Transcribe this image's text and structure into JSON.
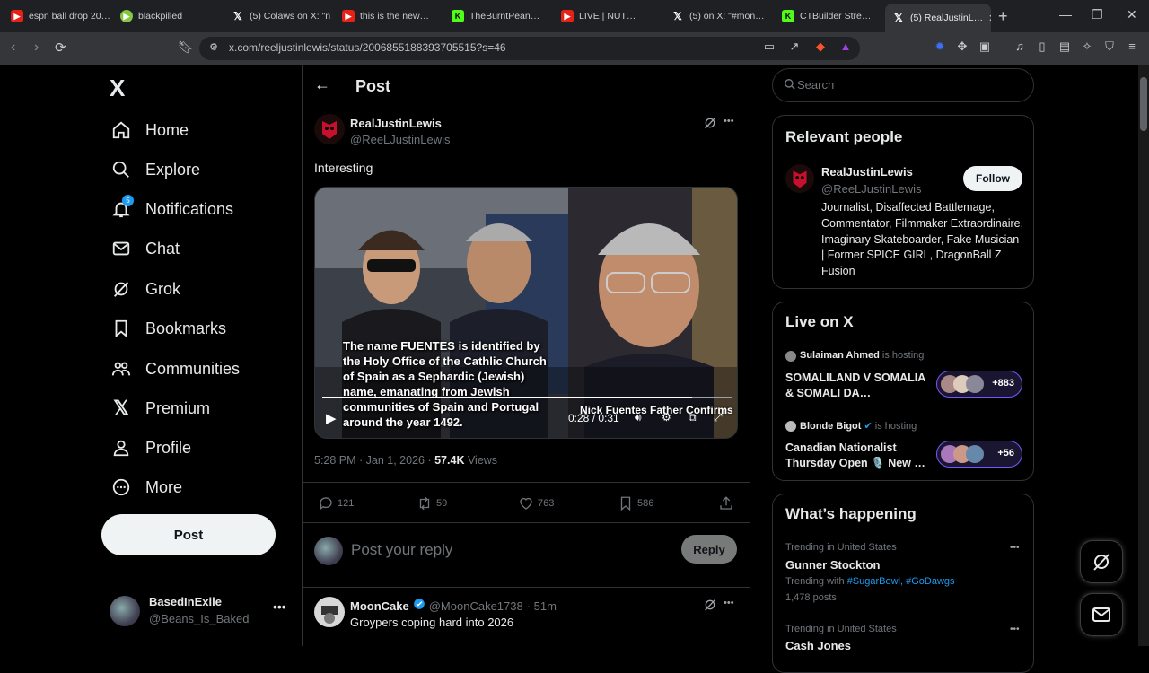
{
  "browser": {
    "tabs": [
      {
        "title": "espn ball drop 20…",
        "icon": "youtube-icon"
      },
      {
        "title": "blackpilled",
        "icon": "rumble-icon"
      },
      {
        "title": "(5) Colaws on X: \"n…",
        "icon": "x-icon"
      },
      {
        "title": "this is the new…",
        "icon": "youtube-icon"
      },
      {
        "title": "TheBurntPean…",
        "icon": "kick-icon"
      },
      {
        "title": "LIVE | NUT…",
        "icon": "youtube-icon"
      },
      {
        "title": "(5) on X: \"#mon…",
        "icon": "x-icon"
      },
      {
        "title": "CTBuilder Stre…",
        "icon": "kick-icon"
      },
      {
        "title": "(5) RealJustinL…",
        "icon": "x-icon",
        "active": true
      }
    ],
    "url": "x.com/reeljustinlewis/status/2006855188393705515?s=46"
  },
  "nav": {
    "logo": "X",
    "items": [
      {
        "label": "Home",
        "icon": "home-icon"
      },
      {
        "label": "Explore",
        "icon": "search-icon"
      },
      {
        "label": "Notifications",
        "icon": "bell-icon",
        "badge": "5"
      },
      {
        "label": "Chat",
        "icon": "mail-icon"
      },
      {
        "label": "Grok",
        "icon": "grok-icon"
      },
      {
        "label": "Bookmarks",
        "icon": "bookmark-icon"
      },
      {
        "label": "Communities",
        "icon": "communities-icon"
      },
      {
        "label": "Premium",
        "icon": "x-premium-icon"
      },
      {
        "label": "Profile",
        "icon": "person-icon"
      },
      {
        "label": "More",
        "icon": "more-circle-icon"
      }
    ],
    "post_button": "Post",
    "account": {
      "name": "BasedInExile",
      "handle": "@Beans_Is_Baked"
    }
  },
  "post": {
    "header": "Post",
    "author_name": "RealJustinLewis",
    "author_handle": "@ReeLJustinLewis",
    "text": "Interesting",
    "video": {
      "caption": "The name FUENTES is identified by the Holy Office of the Cathlic Church of Spain as a Sephardic (Jewish) name, emanating from Jewish communities of Spain and Portugal around the year 1492.",
      "overlay_title": "Nick Fuentes Father Confirms",
      "time": "0:28 / 0:31",
      "progress": 0.903
    },
    "timestamp": "5:28 PM · Jan 1, 2026 · ",
    "views_count": "57.4K",
    "views_label": " Views",
    "stats": {
      "replies": "121",
      "reposts": "59",
      "likes": "763",
      "bookmarks": "586"
    },
    "reply_placeholder": "Post your reply",
    "reply_button": "Reply"
  },
  "comment": {
    "name": "MoonCake",
    "handle": "@MoonCake1738",
    "time": "· 51m",
    "text": "Groypers coping hard into 2026"
  },
  "sidebar": {
    "search_placeholder": "Search",
    "relevant": {
      "title": "Relevant people",
      "name": "RealJustinLewis",
      "handle": "@ReeLJustinLewis",
      "follow": "Follow",
      "bio": "Journalist, Disaffected Battlemage, Commentator, Filmmaker Extraordinaire, Imaginary Skateboarder, Fake Musician | Former SPICE GIRL, DragonBall Z Fusion"
    },
    "live": {
      "title": "Live on X",
      "items": [
        {
          "host": "Sulaiman Ahmed",
          "suffix": "is hosting",
          "title": "SOMALILAND V SOMALIA & SOMALI DA…",
          "count": "+883"
        },
        {
          "host": "Blonde Bigot",
          "suffix": "is hosting",
          "title": "Canadian Nationalist Thursday Open 🎙️ New …",
          "count": "+56"
        }
      ]
    },
    "happening": {
      "title": "What’s happening",
      "trends": [
        {
          "context": "Trending in United States",
          "name": "Gunner Stockton",
          "with_label": "Trending with ",
          "tags": "#SugarBowl, #GoDawgs",
          "posts": "1,478 posts"
        },
        {
          "context": "Trending in United States",
          "name": "Cash Jones"
        }
      ]
    }
  }
}
